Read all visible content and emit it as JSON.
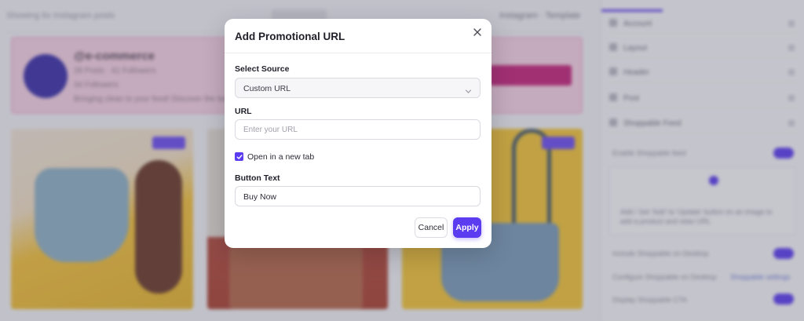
{
  "background": {
    "top_hint": "Showing 6x Instagram posts",
    "tools": "Instagram · Template",
    "banner": {
      "title": "@e-commerce",
      "line1": "28 Posts · 41 Followers",
      "line2": "34 Followers",
      "line3": "Bringing clean to your feed! Discover the best..."
    },
    "sidebar": {
      "items": [
        "Account",
        "Layout",
        "Header",
        "Post",
        "Shoppable Feed"
      ],
      "enable_label": "Enable Shoppable feed",
      "box_text": "Add / Set 'Add' to 'Update' button on an image to add a product and relax URL",
      "opt1": "Include Shoppable on Desktop",
      "opt2": "Configure Shoppable on Desktop",
      "opt2_link": "Shoppable settings",
      "opt3": "Display Shoppable CTA"
    }
  },
  "modal": {
    "title": "Add Promotional URL",
    "select_source": {
      "label": "Select Source",
      "value": "Custom URL"
    },
    "url": {
      "label": "URL",
      "placeholder": "Enter your URL",
      "value": ""
    },
    "new_tab": {
      "label": "Open in a new tab",
      "checked": true
    },
    "button_text": {
      "label": "Button Text",
      "value": "Buy Now"
    },
    "cancel_label": "Cancel",
    "apply_label": "Apply"
  },
  "colors": {
    "accent": "#5b3cf0",
    "banner_bg": "#f7d3e4",
    "banner_button": "#c4237a"
  },
  "icons": {
    "close": "close-icon",
    "select_chevron": "chevron-down-icon",
    "checkbox": "checkmark-icon"
  }
}
